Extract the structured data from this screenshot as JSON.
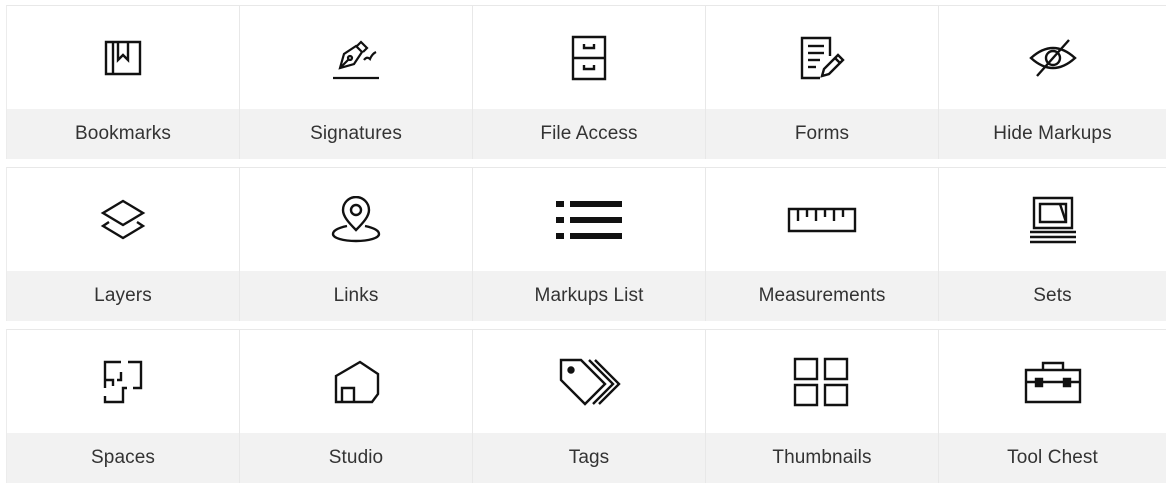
{
  "panels": [
    {
      "label": "Bookmarks",
      "icon": "bookmark-icon"
    },
    {
      "label": "Signatures",
      "icon": "signature-pen-icon"
    },
    {
      "label": "File Access",
      "icon": "file-cabinet-icon"
    },
    {
      "label": "Forms",
      "icon": "form-edit-icon"
    },
    {
      "label": "Hide Markups",
      "icon": "eye-slash-icon"
    },
    {
      "label": "Layers",
      "icon": "layers-icon"
    },
    {
      "label": "Links",
      "icon": "location-pin-icon"
    },
    {
      "label": "Markups List",
      "icon": "list-icon"
    },
    {
      "label": "Measurements",
      "icon": "ruler-icon"
    },
    {
      "label": "Sets",
      "icon": "sets-stack-icon"
    },
    {
      "label": "Spaces",
      "icon": "floor-plan-icon"
    },
    {
      "label": "Studio",
      "icon": "studio-house-icon"
    },
    {
      "label": "Tags",
      "icon": "tags-icon"
    },
    {
      "label": "Thumbnails",
      "icon": "thumbnails-grid-icon"
    },
    {
      "label": "Tool Chest",
      "icon": "toolbox-icon"
    }
  ],
  "colors": {
    "icon_stroke": "#111111",
    "label_bg": "#f2f2f2",
    "label_text": "#333333",
    "divider": "#e8e8e8"
  }
}
